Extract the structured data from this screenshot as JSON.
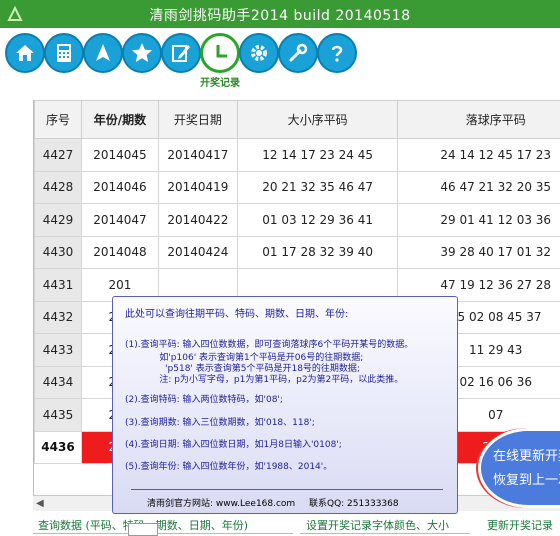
{
  "window": {
    "title": "清雨剑挑码助手2014 build 20140518"
  },
  "toolbar": {
    "buttons": [
      {
        "icon": "home-icon"
      },
      {
        "icon": "calculator-icon"
      },
      {
        "icon": "navigation-arrow-icon"
      },
      {
        "icon": "star-icon"
      },
      {
        "icon": "edit-icon"
      },
      {
        "icon": "clock-icon"
      },
      {
        "icon": "gear-icon"
      },
      {
        "icon": "wrench-icon"
      },
      {
        "icon": "help-icon"
      }
    ],
    "active_label": "开奖记录"
  },
  "table": {
    "headers": [
      "序号",
      "年份/期数",
      "开奖日期",
      "大小序平码",
      "落球序平码"
    ],
    "rows": [
      {
        "seq": "4427",
        "period": "2014045",
        "date": "20140417",
        "sorted": "12 14 17 23 24 45",
        "drawn": "24 14 12 45 17 23"
      },
      {
        "seq": "4428",
        "period": "2014046",
        "date": "20140419",
        "sorted": "20 21 32 35 46 47",
        "drawn": "46 47 21 32 20 35"
      },
      {
        "seq": "4429",
        "period": "2014047",
        "date": "20140422",
        "sorted": "01 03 12 29 36 41",
        "drawn": "29 01 41 12 03 36"
      },
      {
        "seq": "4430",
        "period": "2014048",
        "date": "20140424",
        "sorted": "01 17 28 32 39 40",
        "drawn": "39 28 40 17 01 32"
      },
      {
        "seq": "4431",
        "period": "201",
        "date": "",
        "sorted": "",
        "drawn": "47 19 12 36 27 28"
      },
      {
        "seq": "4432",
        "period": "201",
        "date": "",
        "sorted": "",
        "drawn": "55 02 08 45 37"
      },
      {
        "seq": "4433",
        "period": "201",
        "date": "",
        "sorted": "",
        "drawn": "11 29 43"
      },
      {
        "seq": "4434",
        "period": "201",
        "date": "",
        "sorted": "",
        "drawn": "02 16 06 36"
      },
      {
        "seq": "4435",
        "period": "201",
        "date": "",
        "sorted": "",
        "drawn": "07"
      },
      {
        "seq": "4436",
        "period": "201",
        "date": "",
        "sorted": "",
        "drawn": "2 39"
      }
    ]
  },
  "popup": {
    "lines": [
      "此处可以查询往期平码、特码、期数、日期、年份:",
      "(1).查询平码: 输入四位数数据，即可查询落球序6个平码开某号的数据。",
      "            如'p106' 表示查询第1个平码是开06号的往期数据;",
      "              'p518' 表示查询第5个平码是开18号的往期数据;",
      "            注: p为小写字母，p1为第1平码，p2为第2平码，以此类推。",
      "(2).查询特码: 输入两位数特码，如'08';",
      "(3).查询期数: 输入三位数期数，如'018、118';",
      "(4).查询日期: 输入四位数日期，如1月8日输入'0108';",
      "(5).查询年份: 输入四位数年份，如'1988、2014'。"
    ],
    "website_label": "清雨剑官方网站: www.Lee168.com",
    "qq_label": "联系QQ: 251333368"
  },
  "bubble": {
    "line1": "在线更新开奖",
    "line2": "恢复到上一次"
  },
  "bottom": {
    "query_panel": "查询数据 (平码、特码、期数、日期、年份)",
    "font_panel": "设置开奖记录字体颜色、大小",
    "update_panel": "更新开奖记录"
  },
  "colors": {
    "title_bar": "#3a9a33",
    "toolbar_button": "#1aa2d8",
    "highlight_row": "#ee1c1c",
    "popup_text": "#1e1e9e"
  }
}
